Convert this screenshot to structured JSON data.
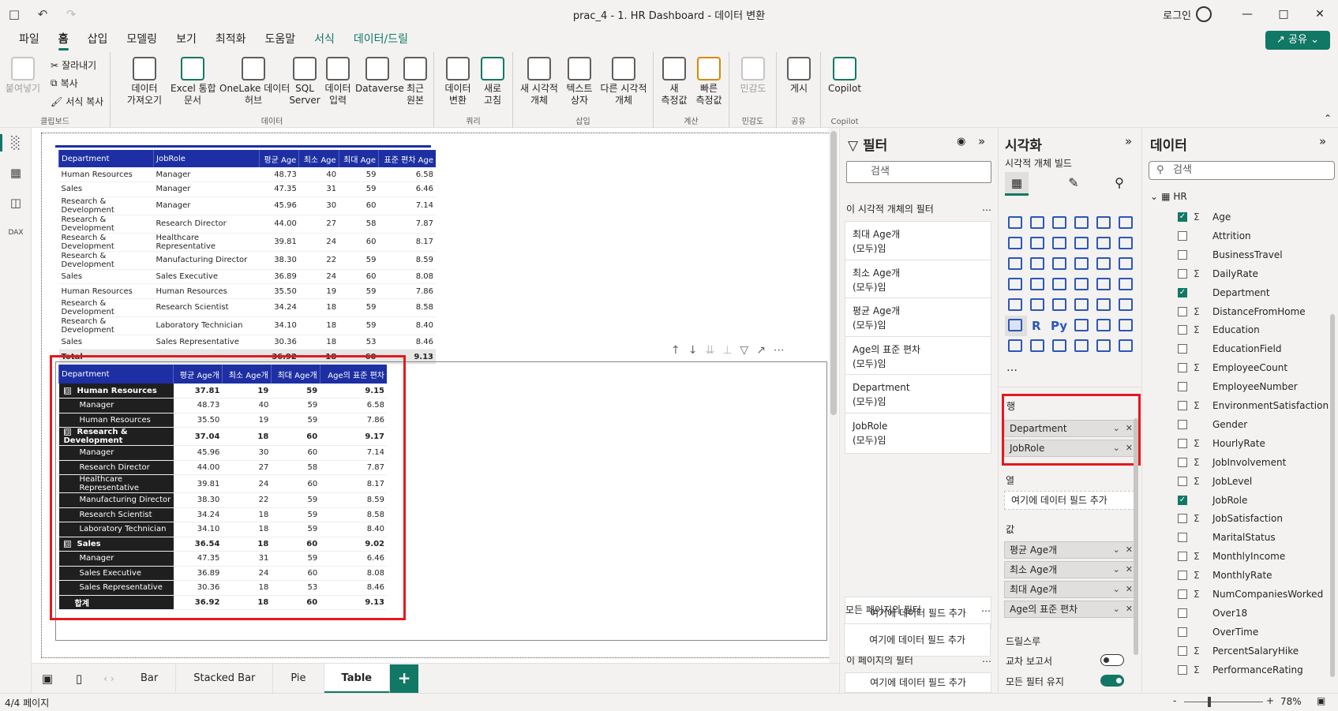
{
  "app": {
    "title": "prac_4 - 1. HR Dashboard - 데이터 변환",
    "login": "로그인",
    "undo_icon": "undo-icon",
    "redo_icon": "redo-icon"
  },
  "menu": [
    "파일",
    "홈",
    "삽입",
    "모델링",
    "보기",
    "최적화",
    "도움말",
    "서식",
    "데이터/드릴"
  ],
  "share": "공유",
  "ribbon": {
    "paste": "붙여넣기",
    "cut": "잘라내기",
    "copy": "복사",
    "format_copy": "서식 복사",
    "clipboard": "클립보드",
    "get_data": "데이터\n가져오기",
    "excel": "Excel 통합\n문서",
    "onelake": "OneLake 데이터\n허브",
    "sql": "SQL\nServer",
    "enter_data": "데이터\n입력",
    "dataverse": "Dataverse",
    "recent": "최근\n원본",
    "data_group": "데이터",
    "transform": "데이터\n변환",
    "refresh": "새로\n고침",
    "query_group": "쿼리",
    "new_visual": "새 시각적\n개체",
    "textbox": "텍스트\n상자",
    "more_visuals": "다른 시각적\n개체",
    "insert_group": "삽입",
    "new_measure": "새\n측정값",
    "quick_measure": "빠른\n측정값",
    "calc_group": "계산",
    "sensitivity": "민감도",
    "sensitivity_group": "민감도",
    "publish": "게시",
    "share_group": "공유",
    "copilot": "Copilot",
    "copilot_group": "Copilot"
  },
  "table1": {
    "headers": [
      "Department",
      "JobRole",
      "평균 Age",
      "최소 Age",
      "최대 Age",
      "표준 편차 Age"
    ],
    "rows": [
      [
        "Human Resources",
        "Manager",
        "48.73",
        "40",
        "59",
        "6.58"
      ],
      [
        "Sales",
        "Manager",
        "47.35",
        "31",
        "59",
        "6.46"
      ],
      [
        "Research & Development",
        "Manager",
        "45.96",
        "30",
        "60",
        "7.14"
      ],
      [
        "Research & Development",
        "Research Director",
        "44.00",
        "27",
        "58",
        "7.87"
      ],
      [
        "Research & Development",
        "Healthcare Representative",
        "39.81",
        "24",
        "60",
        "8.17"
      ],
      [
        "Research & Development",
        "Manufacturing Director",
        "38.30",
        "22",
        "59",
        "8.59"
      ],
      [
        "Sales",
        "Sales Executive",
        "36.89",
        "24",
        "60",
        "8.08"
      ],
      [
        "Human Resources",
        "Human Resources",
        "35.50",
        "19",
        "59",
        "7.86"
      ],
      [
        "Research & Development",
        "Research Scientist",
        "34.24",
        "18",
        "59",
        "8.58"
      ],
      [
        "Research & Development",
        "Laboratory Technician",
        "34.10",
        "18",
        "59",
        "8.40"
      ],
      [
        "Sales",
        "Sales Representative",
        "30.36",
        "18",
        "53",
        "8.46"
      ]
    ],
    "total": [
      "Total",
      "",
      "36.92",
      "18",
      "60",
      "9.13"
    ]
  },
  "table2": {
    "headers": [
      "Department",
      "평균 Age개",
      "최소 Age개",
      "최대 Age개",
      "Age의 표준 편차"
    ],
    "groups": [
      {
        "name": "Human Resources",
        "vals": [
          "37.81",
          "19",
          "59",
          "9.15"
        ],
        "rows": [
          [
            "Manager",
            "48.73",
            "40",
            "59",
            "6.58"
          ],
          [
            "Human Resources",
            "35.50",
            "19",
            "59",
            "7.86"
          ]
        ]
      },
      {
        "name": "Research & Development",
        "vals": [
          "37.04",
          "18",
          "60",
          "9.17"
        ],
        "rows": [
          [
            "Manager",
            "45.96",
            "30",
            "60",
            "7.14"
          ],
          [
            "Research Director",
            "44.00",
            "27",
            "58",
            "7.87"
          ],
          [
            "Healthcare Representative",
            "39.81",
            "24",
            "60",
            "8.17"
          ],
          [
            "Manufacturing Director",
            "38.30",
            "22",
            "59",
            "8.59"
          ],
          [
            "Research Scientist",
            "34.24",
            "18",
            "59",
            "8.58"
          ],
          [
            "Laboratory Technician",
            "34.10",
            "18",
            "59",
            "8.40"
          ]
        ]
      },
      {
        "name": "Sales",
        "vals": [
          "36.54",
          "18",
          "60",
          "9.02"
        ],
        "rows": [
          [
            "Manager",
            "47.35",
            "31",
            "59",
            "6.46"
          ],
          [
            "Sales Executive",
            "36.89",
            "24",
            "60",
            "8.08"
          ],
          [
            "Sales Representative",
            "30.36",
            "18",
            "53",
            "8.46"
          ]
        ]
      }
    ],
    "total": [
      "합계",
      "36.92",
      "18",
      "60",
      "9.13"
    ],
    "toggle": "⊟"
  },
  "pages": [
    "Bar",
    "Stacked Bar",
    "Pie",
    "Table"
  ],
  "status": {
    "page": "4/4 페이지",
    "zoom": "78%",
    "zoom_minus": "-",
    "zoom_plus": "+"
  },
  "filters": {
    "title": "필터",
    "search": "검색",
    "this_visual": "이 시각적 개체의 필터",
    "more": "…",
    "cards": [
      [
        "최대 Age개",
        "(모두)임"
      ],
      [
        "최소 Age개",
        "(모두)임"
      ],
      [
        "평균 Age개",
        "(모두)임"
      ],
      [
        "Age의 표준 편차",
        "(모두)임"
      ],
      [
        "Department",
        "(모두)임"
      ],
      [
        "JobRole",
        "(모두)임"
      ]
    ],
    "add": "여기에 데이터 필드 추가",
    "this_page": "이 페이지의 필터",
    "all_pages": "모든 페이지의 필터"
  },
  "viz": {
    "title": "시각화",
    "build": "시각적 개체 빌드",
    "rows": "행",
    "rows_wells": [
      "Department",
      "JobRole"
    ],
    "columns": "열",
    "columns_add": "여기에 데이터 필드 추가",
    "values": "값",
    "values_wells": [
      "평균 Age개",
      "최소 Age개",
      "최대 Age개",
      "Age의 표준 편차"
    ],
    "drill": "드릴스루",
    "cross": "교차 보고서",
    "keep": "모든 필터 유지",
    "more_dots": "…",
    "r_label": "R",
    "py_label": "Py",
    "toggle_colors": {
      "off": "#ffffff",
      "on": "#117865"
    }
  },
  "data": {
    "title": "데이터",
    "search": "검색",
    "table": "HR",
    "fields": [
      {
        "n": "Age",
        "c": true,
        "s": true
      },
      {
        "n": "Attrition",
        "c": false,
        "s": false
      },
      {
        "n": "BusinessTravel",
        "c": false,
        "s": false
      },
      {
        "n": "DailyRate",
        "c": false,
        "s": true
      },
      {
        "n": "Department",
        "c": true,
        "s": false
      },
      {
        "n": "DistanceFromHome",
        "c": false,
        "s": true
      },
      {
        "n": "Education",
        "c": false,
        "s": true
      },
      {
        "n": "EducationField",
        "c": false,
        "s": false
      },
      {
        "n": "EmployeeCount",
        "c": false,
        "s": true
      },
      {
        "n": "EmployeeNumber",
        "c": false,
        "s": false
      },
      {
        "n": "EnvironmentSatisfaction",
        "c": false,
        "s": true
      },
      {
        "n": "Gender",
        "c": false,
        "s": false
      },
      {
        "n": "HourlyRate",
        "c": false,
        "s": true
      },
      {
        "n": "JobInvolvement",
        "c": false,
        "s": true
      },
      {
        "n": "JobLevel",
        "c": false,
        "s": true
      },
      {
        "n": "JobRole",
        "c": true,
        "s": false
      },
      {
        "n": "JobSatisfaction",
        "c": false,
        "s": true
      },
      {
        "n": "MaritalStatus",
        "c": false,
        "s": false
      },
      {
        "n": "MonthlyIncome",
        "c": false,
        "s": true
      },
      {
        "n": "MonthlyRate",
        "c": false,
        "s": true
      },
      {
        "n": "NumCompaniesWorked",
        "c": false,
        "s": true
      },
      {
        "n": "Over18",
        "c": false,
        "s": false
      },
      {
        "n": "OverTime",
        "c": false,
        "s": false
      },
      {
        "n": "PercentSalaryHike",
        "c": false,
        "s": true
      },
      {
        "n": "PerformanceRating",
        "c": false,
        "s": true
      }
    ],
    "sigma": "Σ",
    "check": "✓"
  },
  "colors": {
    "accent": "#117865",
    "header": "#1d2fa3",
    "highlight": "#e3191d"
  }
}
